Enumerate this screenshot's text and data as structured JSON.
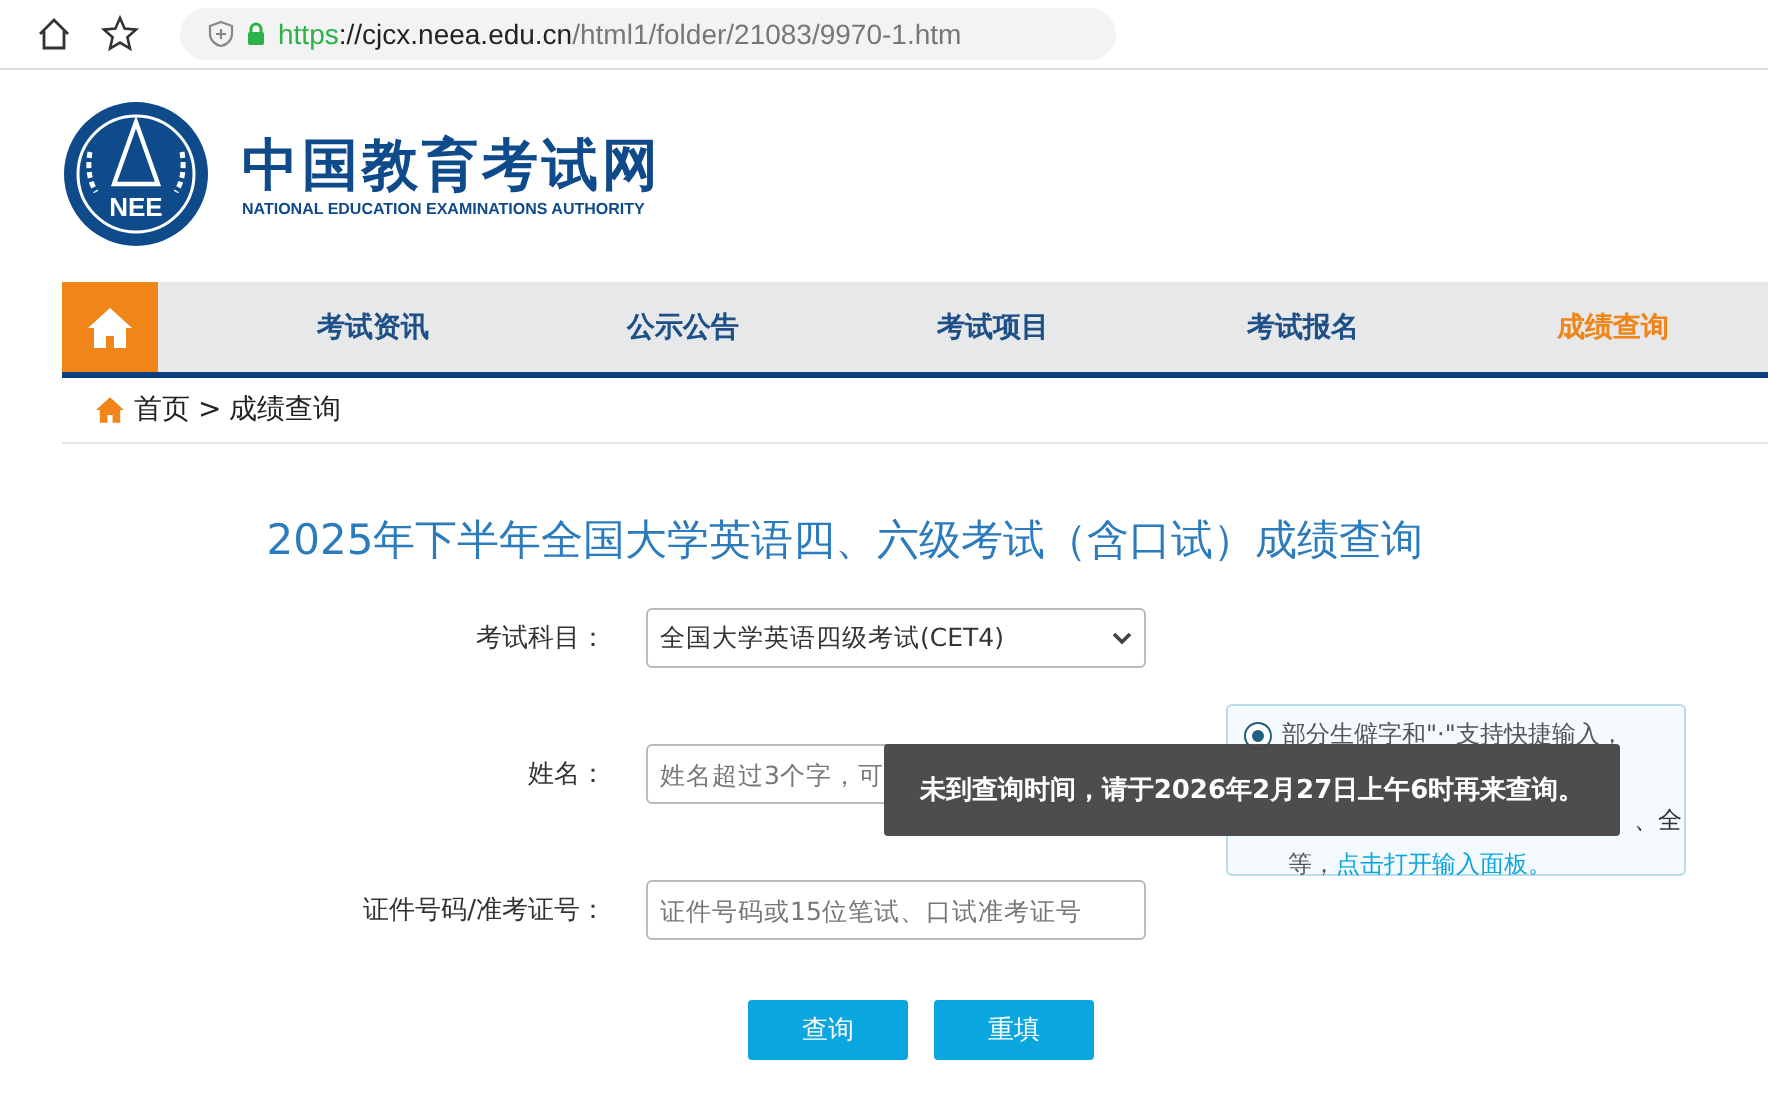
{
  "browser": {
    "url": {
      "scheme": "https",
      "host": "://cjcx.neea.edu.cn",
      "path": "/html1/folder/21083/9970-1.htm"
    }
  },
  "logo": {
    "emblem_text": "NEE",
    "title": "中国教育考试网",
    "subtitle": "NATIONAL EDUCATION EXAMINATIONS AUTHORITY"
  },
  "nav": {
    "items": [
      {
        "label": "考试资讯",
        "selected": false
      },
      {
        "label": "公示公告",
        "selected": false
      },
      {
        "label": "考试项目",
        "selected": false
      },
      {
        "label": "考试报名",
        "selected": false
      },
      {
        "label": "成绩查询",
        "selected": true
      }
    ]
  },
  "breadcrumb": {
    "home": "首页",
    "separator": ">",
    "current": "成绩查询"
  },
  "title": "2025年下半年全国大学英语四、六级考试（含口试）成绩查询",
  "form": {
    "fields": [
      {
        "kind": "select",
        "label": "考试科目：",
        "value": "全国大学英语四级考试(CET4)"
      },
      {
        "kind": "input",
        "label": "姓名：",
        "placeholder": "姓名超过3个字，可"
      },
      {
        "kind": "input",
        "label": "证件号码/准考证号：",
        "placeholder": "证件号码或15位笔试、口试准考证号"
      }
    ],
    "buttons": [
      "查询",
      "重填"
    ]
  },
  "help": {
    "checked": true,
    "line_1": "部分生僻字和\"·\"支持快捷输入，",
    "line_2_visible": "、全",
    "line_3": "等，",
    "link": "点击打开输入面板。"
  },
  "toast": "未到查询时间，请于2026年2月27日上午6时再来查询。"
}
